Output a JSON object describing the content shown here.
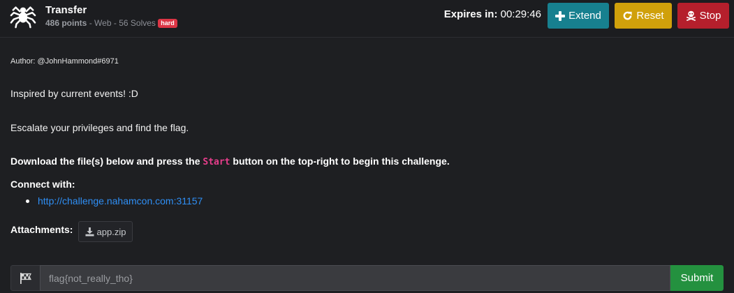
{
  "header": {
    "title": "Transfer",
    "points": "486 points",
    "category": "Web",
    "solves": "56 Solves",
    "difficulty_badge": "hard",
    "expires_label": "Expires in",
    "expires_value": "00:29:46",
    "extend_label": "Extend",
    "reset_label": "Reset",
    "stop_label": "Stop",
    "colors": {
      "extend": "#17808f",
      "reset": "#d0a00b",
      "stop": "#b51f2c",
      "badge": "#dc3545"
    }
  },
  "challenge": {
    "author": "Author: @JohnHammond#6971",
    "line1": "Inspired by current events! :D",
    "line2": "Escalate your privileges and find the flag.",
    "instruction_pre": "Download the file(s) below and press the ",
    "instruction_code": "Start",
    "instruction_post": " button on the top-right to begin this challenge.",
    "connect_label": "Connect with:",
    "connect_link": "http://challenge.nahamcon.com:31157",
    "attachments_label": "Attachments:",
    "attachment_file": "app.zip"
  },
  "flag_form": {
    "placeholder": "flag{not_really_tho}",
    "submit_label": "Submit",
    "submit_color": "#24913f"
  },
  "icons": [
    "spider-icon",
    "plus-icon",
    "redo-icon",
    "skull-crossbones-icon",
    "download-icon",
    "checkered-flag-icon"
  ]
}
